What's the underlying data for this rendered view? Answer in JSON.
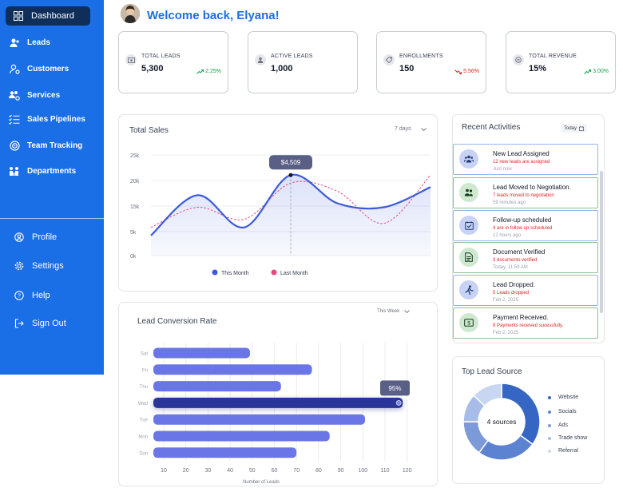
{
  "sidebar": {
    "items": [
      {
        "label": "Dashboard",
        "icon": "grid-icon"
      },
      {
        "label": "Leads",
        "icon": "user-plus-icon"
      },
      {
        "label": "Customers",
        "icon": "user-gear-icon"
      },
      {
        "label": "Services",
        "icon": "users-gear-icon"
      },
      {
        "label": "Sales Pipelines",
        "icon": "checklist-icon"
      },
      {
        "label": "Team Tracking",
        "icon": "target-icon"
      },
      {
        "label": "Departments",
        "icon": "department-icon"
      }
    ],
    "lower": [
      {
        "label": "Profile",
        "icon": "profile-icon"
      },
      {
        "label": "Settings",
        "icon": "gear-icon"
      },
      {
        "label": "Help",
        "icon": "help-icon"
      },
      {
        "label": "Sign Out",
        "icon": "sign-out-icon"
      }
    ]
  },
  "header": {
    "welcome": "Welcome back, Elyana!"
  },
  "stats": [
    {
      "label": "TOTAL LEADS",
      "value": "5,300",
      "change": "2.25%",
      "trend": "up"
    },
    {
      "label": "ACTIVE LEADS",
      "value": "1,000",
      "change": "",
      "trend": "none"
    },
    {
      "label": "ENROLLMENTS",
      "value": "150",
      "change": "5.56%",
      "trend": "down"
    },
    {
      "label": "TOTAL REVENUE",
      "value": "15%",
      "change": "3.00%",
      "trend": "up"
    }
  ],
  "total_sales": {
    "title": "Total Sales",
    "range": "7 days",
    "tooltip": "$4,509",
    "yticks": [
      "25k",
      "20k",
      "15k",
      "5k",
      "0k"
    ],
    "legend": [
      "This Month",
      "Last Month"
    ]
  },
  "lead_conversion": {
    "title": "Lead Conversion Rate",
    "range": "This Week",
    "tooltip": "95%",
    "xlabel": "Number of Leads",
    "xticks": [
      "10",
      "20",
      "30",
      "40",
      "50",
      "60",
      "70",
      "80",
      "90",
      "100",
      "110",
      "120"
    ]
  },
  "recent": {
    "title": "Recent Activities",
    "filter": "Today",
    "items": [
      {
        "title": "New Lead Assigned",
        "sub": "12 new leads are assigned",
        "time": "Just now",
        "icon": "group-icon",
        "tone": "blue"
      },
      {
        "title": "Lead Moved to Negotiation.",
        "sub": "7 leads moved to negotiation",
        "time": "59 minutes ago",
        "icon": "handshake-icon",
        "tone": "green"
      },
      {
        "title": "Follow-up scheduled",
        "sub": "4 are in follow up scheduled",
        "time": "12 hours ago",
        "icon": "calendar-check-icon",
        "tone": "blue"
      },
      {
        "title": "Document Verified",
        "sub": "3 documents verified",
        "time": "Today, 11:59 AM",
        "icon": "document-icon",
        "tone": "green"
      },
      {
        "title": "Lead Dropped.",
        "sub": "5 Leads dropped",
        "time": "Feb 2, 2025",
        "icon": "drop-icon",
        "tone": "blue"
      },
      {
        "title": "Payment Received.",
        "sub": "8 Payments received sucessfully.",
        "time": "Feb 2, 2025",
        "icon": "payment-icon",
        "tone": "green"
      }
    ]
  },
  "lead_source": {
    "title": "Top Lead Source",
    "center": "4 sources",
    "legend": [
      "Website",
      "Socials",
      "Ads",
      "Trade show",
      "Referral"
    ]
  },
  "colors": {
    "sidebar": "#1a6ee6",
    "active_nav": "#0f2f5a",
    "accent": "#1a6ee6",
    "this_month": "#3b5bdb",
    "last_month": "#e64980",
    "bar": "#6b76e6",
    "bar_active": "#2a3699",
    "positive": "#16a34a",
    "negative": "#dc2626"
  },
  "chart_data": [
    {
      "type": "line",
      "title": "Total Sales",
      "x": [
        1,
        2,
        3,
        4,
        5,
        6,
        7
      ],
      "yticks": [
        "25k",
        "20k",
        "15k",
        "5k",
        "0k"
      ],
      "series": [
        {
          "name": "This Month",
          "values": [
            5,
            15,
            7,
            20,
            13,
            12,
            17
          ]
        },
        {
          "name": "Last Month",
          "values": [
            7,
            12,
            9,
            18,
            16,
            8,
            20
          ]
        }
      ],
      "highlight": {
        "index": 3,
        "label": "$4,509"
      }
    },
    {
      "type": "bar",
      "title": "Lead Conversion Rate",
      "orientation": "horizontal",
      "categories": [
        "Sat",
        "Fri",
        "Thu",
        "Wed",
        "Tue",
        "Mon",
        "Sun"
      ],
      "values": [
        49,
        77,
        63,
        118,
        101,
        85,
        70
      ],
      "xlim": [
        0,
        125
      ],
      "xlabel": "Number of Leads",
      "highlight": {
        "category": "Wed",
        "label": "95%"
      }
    },
    {
      "type": "pie",
      "title": "Top Lead Source",
      "categories": [
        "Website",
        "Socials",
        "Ads",
        "Trade show",
        "Referral"
      ],
      "values": [
        35,
        25,
        15,
        12,
        13
      ]
    }
  ]
}
